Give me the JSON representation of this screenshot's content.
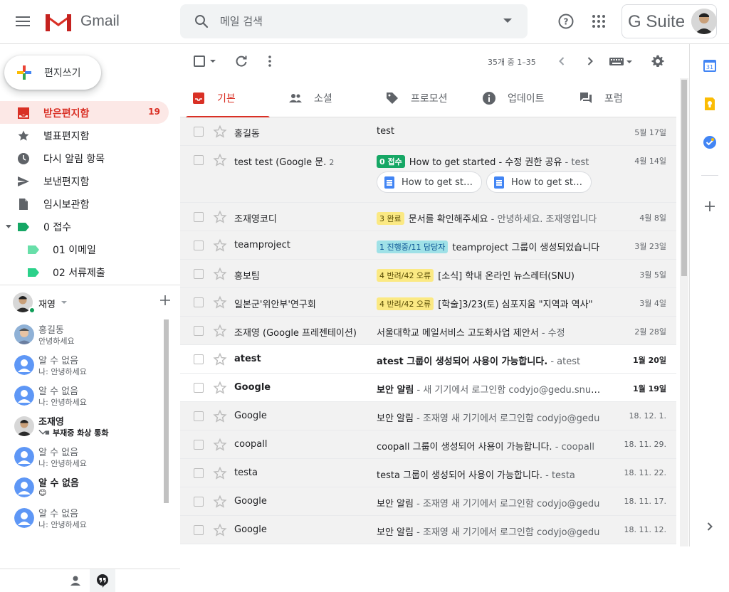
{
  "header": {
    "app_name": "Gmail",
    "search_placeholder": "메일 검색",
    "gsuite_label": "G Suite",
    "help_icon": "help-icon",
    "apps_icon": "apps-grid-icon"
  },
  "sidebar": {
    "compose_label": "편지쓰기",
    "items": [
      {
        "label": "받은편지함",
        "count": "19",
        "icon": "inbox-icon"
      },
      {
        "label": "별표편지함",
        "count": "",
        "icon": "star-icon"
      },
      {
        "label": "다시 알림 항목",
        "count": "",
        "icon": "clock-icon"
      },
      {
        "label": "보낸편지함",
        "count": "",
        "icon": "send-icon"
      },
      {
        "label": "임시보관함",
        "count": "",
        "icon": "draft-icon"
      },
      {
        "label": "0 접수",
        "count": "",
        "icon": "label-icon"
      },
      {
        "label": "01 이메일",
        "count": "",
        "icon": "label-icon"
      },
      {
        "label": "02 서류제출",
        "count": "",
        "icon": "label-icon"
      }
    ]
  },
  "hangouts": {
    "me_name": "재영",
    "contacts": [
      {
        "name": "홍길동",
        "status": "안녕하세요",
        "bold": false
      },
      {
        "name": "알 수 없음",
        "status": "나: 안녕하세요",
        "bold": false
      },
      {
        "name": "알 수 없음",
        "status": "나: 안녕하세요",
        "bold": false
      },
      {
        "name": "조재영",
        "status": "부재중 화상 통화",
        "bold": true
      },
      {
        "name": "알 수 없음",
        "status": "나: 안녕하세요",
        "bold": false
      },
      {
        "name": "알 수 없음",
        "status": "😊",
        "bold": true
      },
      {
        "name": "알 수 없음",
        "status": "나: 안녕하세요",
        "bold": false
      }
    ]
  },
  "toolbar": {
    "count_text": "35개 중 1–35"
  },
  "tabs": [
    {
      "label": "기본",
      "icon": "inbox-tab-icon",
      "active": true
    },
    {
      "label": "소셜",
      "icon": "people-icon",
      "active": false
    },
    {
      "label": "프로모션",
      "icon": "tag-icon",
      "active": false
    },
    {
      "label": "업데이트",
      "icon": "info-icon",
      "active": false
    },
    {
      "label": "포럼",
      "icon": "forum-icon",
      "active": false
    }
  ],
  "emails": [
    {
      "sender": "홍길동",
      "thread": "",
      "label": "",
      "label_color": "",
      "subject": "test",
      "snippet": "",
      "date": "5월 17일",
      "unread": false,
      "chips": []
    },
    {
      "sender": "test test (Google 문.",
      "thread": "2",
      "label": "0 접수",
      "label_color": "green",
      "subject": "How to get started - 수정 권한 공유",
      "snippet": " - test",
      "date": "4월 14일",
      "unread": false,
      "chips": [
        "How to get started",
        "How to get started"
      ]
    },
    {
      "sender": "조재영코디",
      "thread": "",
      "label": "3 완료",
      "label_color": "yellow",
      "subject": "문서를 확인해주세요",
      "snippet": " - 안녕하세요. 조재영입니다",
      "date": "4월 8일",
      "unread": false,
      "chips": []
    },
    {
      "sender": "teamproject",
      "thread": "",
      "label": "1 진행중/11 담당자",
      "label_color": "blue",
      "subject": "teamproject 그룹이 생성되었습니다",
      "snippet": "",
      "date": "3월 23일",
      "unread": false,
      "chips": []
    },
    {
      "sender": "홍보팀",
      "thread": "",
      "label": "4 반려/42 오류",
      "label_color": "yellow",
      "subject": "[소식] 학내 온라인 뉴스레터(SNU)",
      "snippet": "",
      "date": "3월 5일",
      "unread": false,
      "chips": []
    },
    {
      "sender": "일본군'위안부'연구회",
      "thread": "",
      "label": "4 반려/42 오류",
      "label_color": "yellow",
      "subject": "[학술]3/23(토) 심포지움 \"지역과 역사\"",
      "snippet": "",
      "date": "3월 4일",
      "unread": false,
      "chips": []
    },
    {
      "sender": "조재영 (Google 프레젠테이션)",
      "thread": "",
      "label": "",
      "label_color": "",
      "subject": "서울대학교 메일서비스 고도화사업 제안서",
      "snippet": " - 수정",
      "date": "2월 28일",
      "unread": false,
      "chips": []
    },
    {
      "sender": "atest",
      "thread": "",
      "label": "",
      "label_color": "",
      "subject": "atest 그룹이 생성되어 사용이 가능합니다.",
      "snippet": " - atest",
      "date": "1월 20일",
      "unread": true,
      "chips": []
    },
    {
      "sender": "Google",
      "thread": "",
      "label": "",
      "label_color": "",
      "subject": "보안 알림",
      "snippet": " - 새 기기에서 로그인함 codyjo@gedu.snu.ac.kr",
      "date": "1월 19일",
      "unread": true,
      "chips": []
    },
    {
      "sender": "Google",
      "thread": "",
      "label": "",
      "label_color": "",
      "subject": "보안 알림",
      "snippet": " - 조재영 새 기기에서 로그인함 codyjo@gedu",
      "date": "18. 12. 1.",
      "unread": false,
      "chips": []
    },
    {
      "sender": "coopall",
      "thread": "",
      "label": "",
      "label_color": "",
      "subject": "coopall 그룹이 생성되어 사용이 가능합니다.",
      "snippet": " - coopall",
      "date": "18. 11. 29.",
      "unread": false,
      "chips": []
    },
    {
      "sender": "testa",
      "thread": "",
      "label": "",
      "label_color": "",
      "subject": "testa 그룹이 생성되어 사용이 가능합니다.",
      "snippet": " - testa",
      "date": "18. 11. 22.",
      "unread": false,
      "chips": []
    },
    {
      "sender": "Google",
      "thread": "",
      "label": "",
      "label_color": "",
      "subject": "보안 알림",
      "snippet": " - 조재영 새 기기에서 로그인함 codyjo@gedu",
      "date": "18. 11. 17.",
      "unread": false,
      "chips": []
    },
    {
      "sender": "Google",
      "thread": "",
      "label": "",
      "label_color": "",
      "subject": "보안 알림",
      "snippet": " - 조재영 새 기기에서 로그인함 codyjo@gedu",
      "date": "18. 11. 12.",
      "unread": false,
      "chips": []
    }
  ],
  "colors": {
    "accent_red": "#d93025",
    "label_green": "#16a765",
    "label_yellow": "#fbe983",
    "label_blue": "#9fe1e7"
  }
}
